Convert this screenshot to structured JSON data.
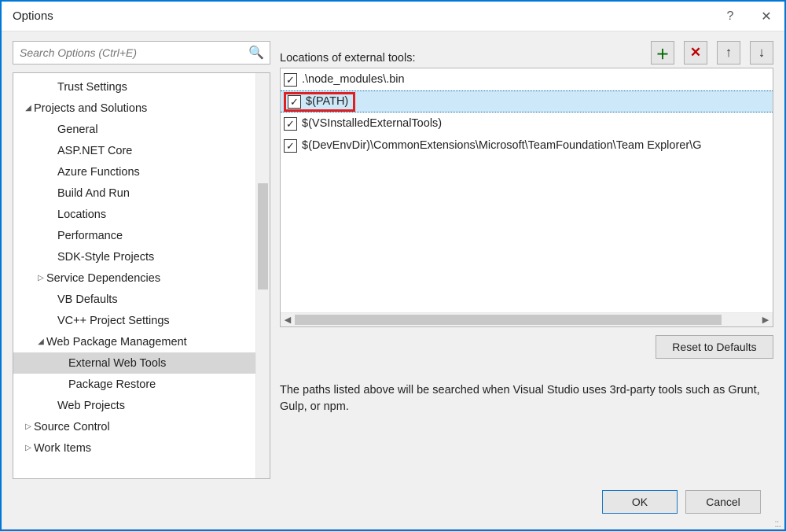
{
  "window": {
    "title": "Options"
  },
  "search": {
    "placeholder": "Search Options (Ctrl+E)"
  },
  "tree": [
    {
      "label": "Trust Settings",
      "indent": 42,
      "expander": ""
    },
    {
      "label": "Projects and Solutions",
      "indent": 12,
      "expander": "◢"
    },
    {
      "label": "General",
      "indent": 42,
      "expander": ""
    },
    {
      "label": "ASP.NET Core",
      "indent": 42,
      "expander": ""
    },
    {
      "label": "Azure Functions",
      "indent": 42,
      "expander": ""
    },
    {
      "label": "Build And Run",
      "indent": 42,
      "expander": ""
    },
    {
      "label": "Locations",
      "indent": 42,
      "expander": ""
    },
    {
      "label": "Performance",
      "indent": 42,
      "expander": ""
    },
    {
      "label": "SDK-Style Projects",
      "indent": 42,
      "expander": ""
    },
    {
      "label": "Service Dependencies",
      "indent": 28,
      "expander": "▷"
    },
    {
      "label": "VB Defaults",
      "indent": 42,
      "expander": ""
    },
    {
      "label": "VC++ Project Settings",
      "indent": 42,
      "expander": ""
    },
    {
      "label": "Web Package Management",
      "indent": 28,
      "expander": "◢"
    },
    {
      "label": "External Web Tools",
      "indent": 56,
      "expander": "",
      "selected": true
    },
    {
      "label": "Package Restore",
      "indent": 56,
      "expander": ""
    },
    {
      "label": "Web Projects",
      "indent": 42,
      "expander": ""
    },
    {
      "label": "Source Control",
      "indent": 12,
      "expander": "▷"
    },
    {
      "label": "Work Items",
      "indent": 12,
      "expander": "▷"
    }
  ],
  "right": {
    "label": "Locations of external tools:",
    "items": [
      {
        "checked": true,
        "text": ".\\node_modules\\.bin"
      },
      {
        "checked": true,
        "text": "$(PATH)",
        "selected": true,
        "highlighted": true
      },
      {
        "checked": true,
        "text": "$(VSInstalledExternalTools)"
      },
      {
        "checked": true,
        "text": "$(DevEnvDir)\\CommonExtensions\\Microsoft\\TeamFoundation\\Team Explorer\\G"
      }
    ],
    "reset": "Reset to Defaults",
    "hint": "The paths listed above will be searched when Visual Studio uses 3rd-party tools such as Grunt, Gulp, or npm."
  },
  "buttons": {
    "ok": "OK",
    "cancel": "Cancel"
  },
  "toolbar": {
    "add": "＋",
    "del": "✕",
    "up": "↑",
    "down": "↓"
  }
}
